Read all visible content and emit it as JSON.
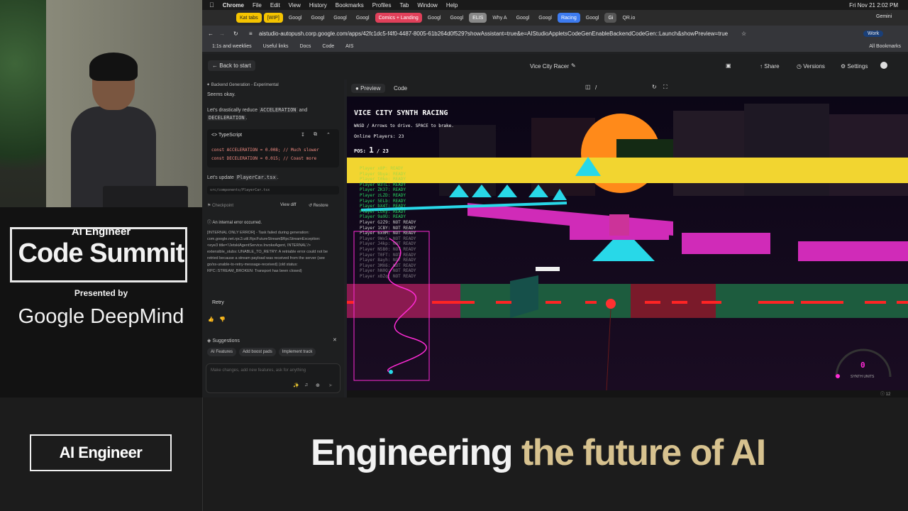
{
  "podium": {
    "ai_engineer": "AI Engineer",
    "code_summit": "Code Summit",
    "presented_by": "Presented by",
    "sponsor": "Google DeepMind"
  },
  "banner": {
    "logo": "AI Engineer",
    "tagline_white": "Engineering",
    "tagline_gold": "the future of AI"
  },
  "menubar": {
    "apple": "",
    "items": [
      "Chrome",
      "File",
      "Edit",
      "View",
      "History",
      "Bookmarks",
      "Profiles",
      "Tab",
      "Window",
      "Help"
    ],
    "clock": "Fri Nov 21  2:02 PM"
  },
  "tabs": [
    {
      "label": "Kat tabs",
      "color": "#f5c400"
    },
    {
      "label": "[WIP]",
      "color": "#f5c400"
    },
    {
      "label": "Googl",
      "color": ""
    },
    {
      "label": "Googl",
      "color": ""
    },
    {
      "label": "Googl",
      "color": ""
    },
    {
      "label": "Googl",
      "color": ""
    },
    {
      "label": "Comics + Landing",
      "color": "#e0405a"
    },
    {
      "label": "Googl",
      "color": ""
    },
    {
      "label": "Googl",
      "color": ""
    },
    {
      "label": "ELIS",
      "color": "#888"
    },
    {
      "label": "Why A",
      "color": ""
    },
    {
      "label": "Googl",
      "color": ""
    },
    {
      "label": "Googl",
      "color": ""
    },
    {
      "label": "Racing",
      "color": "#3d7bf0"
    },
    {
      "label": "Googl",
      "color": ""
    },
    {
      "label": "Gi",
      "color": "#555"
    },
    {
      "label": "QR.io",
      "color": ""
    }
  ],
  "address": {
    "url": "aistudio-autopush.corp.google.com/apps/42fc1dc5-f4f0-4487-8005-61b264d0f529?showAssistant=true&e=AIStudioAppletsCodeGenEnableBackendCodeGen::Launch&showPreview=true",
    "profile": "Work",
    "gemini": "Gemini"
  },
  "bookmarks": {
    "items": [
      "1:1s and weeklies",
      "Useful links",
      "Docs",
      "Code",
      "AIS"
    ],
    "all": "All Bookmarks"
  },
  "appbar": {
    "back": "Back to start",
    "title": "Vice City Racer",
    "share": "Share",
    "versions": "Versions",
    "settings": "Settings"
  },
  "chat": {
    "badge": "Backend Generation - Experimental",
    "msg1": "Seems okay.",
    "msg2a": "Let's drastically reduce",
    "msg2_code1": "ACCELERATION",
    "msg2b": "and",
    "msg2_code2": "DECELERATION",
    "code_lang": "TypeScript",
    "code_line1": "const ACCELERATION = 0.008; // Much slower",
    "code_line2": "const DECELERATION = 0.015; // Coast more",
    "msg3": "Let's update",
    "msg3_code": "PlayerCar.tsx",
    "file_path": "src/components/PlayerCar.tsx",
    "checkpoint": "Checkpoint",
    "view_diff": "View diff",
    "restore": "Restore",
    "error_title": "An internal error occurred.",
    "error_body": "[INTERNAL ONLY ERROR] - Task failed during generation: com.google.net.rpc3.util.RpcFutureStream$RpcStreamException: <eye3 title='/JetskiAgentService.InvokeAgent, INTERNAL'/> extensible_stubs::UNABLE_TO_RETRY: A retriable error could not be retried because a stream payload was received from the server (see go/xs-unable-to-retry-message-received) (old status: RPC::STREAM_BROKEN: Transport has been closed)",
    "retry": "Retry",
    "suggestions": "Suggestions",
    "chips": [
      "AI Features",
      "Add boost pads",
      "Implement track"
    ],
    "input_placeholder": "Make changes, add new features, ask for anything"
  },
  "preview": {
    "tab_preview": "Preview",
    "tab_code": "Code",
    "path": "/"
  },
  "game": {
    "title": "VICE CITY SYNTH RACING",
    "controls": "WASD / Arrows to drive. SPACE to brake.",
    "online": "Online Players: 23",
    "pos_label": "POS:",
    "pos_value": "1",
    "pos_total": "/ 23",
    "players": [
      "Player x8P: READY",
      "Player 9bya: READY",
      "Player t0ko: READY",
      "Player W3TL: READY",
      "Player ZK37: READY",
      "Player zLZD: READY",
      "Player 5ELb: READY",
      "Player bX4T: READY",
      "Player LoRy: READY",
      "Player 9a9U: READY",
      "Player G2Z9: NOT READY",
      "Player 1CBY: NOT READY",
      "Player 6x0M: NOT READY",
      "Player 9Wx5: NOT READY",
      "Player J4kp: NOT READY",
      "Player N5B0: NOT READY",
      "Player T0FT: NOT READY",
      "Player 8ayh: NOT READY",
      "Player 3MX6: NOT READY",
      "Player hN0Q: NOT READY",
      "Player xBZq: NOT READY"
    ],
    "speed_value": "0",
    "speed_unit": "SYNTH UNITS"
  },
  "statusbar": {
    "count": "12"
  },
  "colors": {
    "accent_blue": "#8ab4f8",
    "neon_pink": "#ff2bd6",
    "neon_cyan": "#28d8e8",
    "neon_yellow": "#f2d530",
    "sun_orange": "#ff8a1a"
  }
}
